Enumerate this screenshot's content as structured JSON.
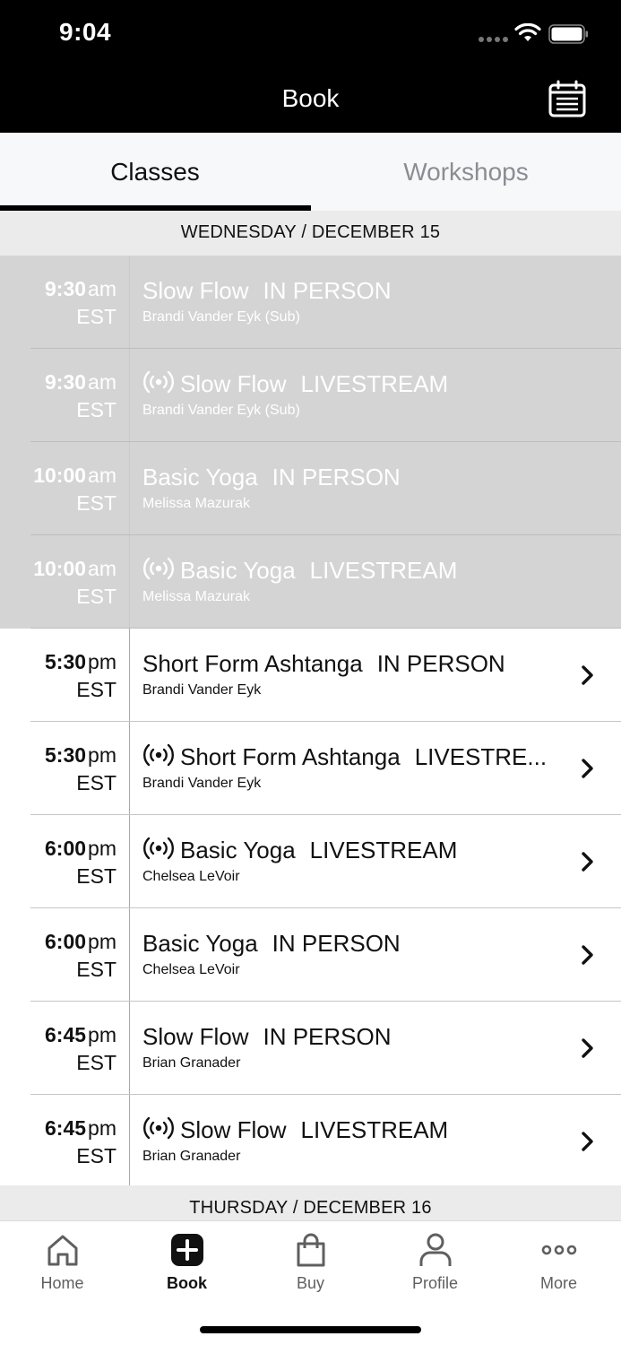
{
  "status_bar": {
    "time": "9:04"
  },
  "nav": {
    "title": "Book",
    "calendar_icon": "calendar-icon"
  },
  "tabs": [
    {
      "label": "Classes",
      "active": true
    },
    {
      "label": "Workshops",
      "active": false
    }
  ],
  "days": [
    {
      "header": "WEDNESDAY / DECEMBER 15",
      "classes": [
        {
          "time": "9:30",
          "ampm": "am",
          "tz": "EST",
          "livestream": false,
          "name": "Slow Flow",
          "type": "IN PERSON",
          "instructor": "Brandi Vander Eyk (Sub)",
          "past": true
        },
        {
          "time": "9:30",
          "ampm": "am",
          "tz": "EST",
          "livestream": true,
          "name": "Slow Flow",
          "type": "LIVESTREAM",
          "instructor": "Brandi Vander Eyk (Sub)",
          "past": true
        },
        {
          "time": "10:00",
          "ampm": "am",
          "tz": "EST",
          "livestream": false,
          "name": "Basic Yoga",
          "type": "IN PERSON",
          "instructor": "Melissa Mazurak",
          "past": true
        },
        {
          "time": "10:00",
          "ampm": "am",
          "tz": "EST",
          "livestream": true,
          "name": "Basic Yoga",
          "type": "LIVESTREAM",
          "instructor": "Melissa Mazurak",
          "past": true
        },
        {
          "time": "5:30",
          "ampm": "pm",
          "tz": "EST",
          "livestream": false,
          "name": "Short Form Ashtanga",
          "type": "IN PERSON",
          "instructor": "Brandi Vander Eyk",
          "past": false
        },
        {
          "time": "5:30",
          "ampm": "pm",
          "tz": "EST",
          "livestream": true,
          "name": "Short Form Ashtanga",
          "type": "LIVESTRE...",
          "instructor": "Brandi Vander Eyk",
          "past": false
        },
        {
          "time": "6:00",
          "ampm": "pm",
          "tz": "EST",
          "livestream": true,
          "name": "Basic Yoga",
          "type": "LIVESTREAM",
          "instructor": "Chelsea LeVoir",
          "past": false
        },
        {
          "time": "6:00",
          "ampm": "pm",
          "tz": "EST",
          "livestream": false,
          "name": "Basic Yoga",
          "type": "IN PERSON",
          "instructor": "Chelsea LeVoir",
          "past": false
        },
        {
          "time": "6:45",
          "ampm": "pm",
          "tz": "EST",
          "livestream": false,
          "name": "Slow Flow",
          "type": "IN PERSON",
          "instructor": "Brian Granader",
          "past": false
        },
        {
          "time": "6:45",
          "ampm": "pm",
          "tz": "EST",
          "livestream": true,
          "name": "Slow Flow",
          "type": "LIVESTREAM",
          "instructor": "Brian Granader",
          "past": false
        }
      ]
    },
    {
      "header": "THURSDAY / DECEMBER 16",
      "classes": []
    }
  ],
  "tab_bar": [
    {
      "label": "Home",
      "icon": "home-icon",
      "active": false
    },
    {
      "label": "Book",
      "icon": "plus-square-icon",
      "active": true
    },
    {
      "label": "Buy",
      "icon": "shopping-bag-icon",
      "active": false
    },
    {
      "label": "Profile",
      "icon": "person-icon",
      "active": false
    },
    {
      "label": "More",
      "icon": "more-dots-icon",
      "active": false
    }
  ],
  "colors": {
    "header_bg": "#000000",
    "past_row_bg": "#d4d4d4",
    "day_header_bg": "#ebebeb",
    "inactive_tab_text": "#8b8d93"
  }
}
